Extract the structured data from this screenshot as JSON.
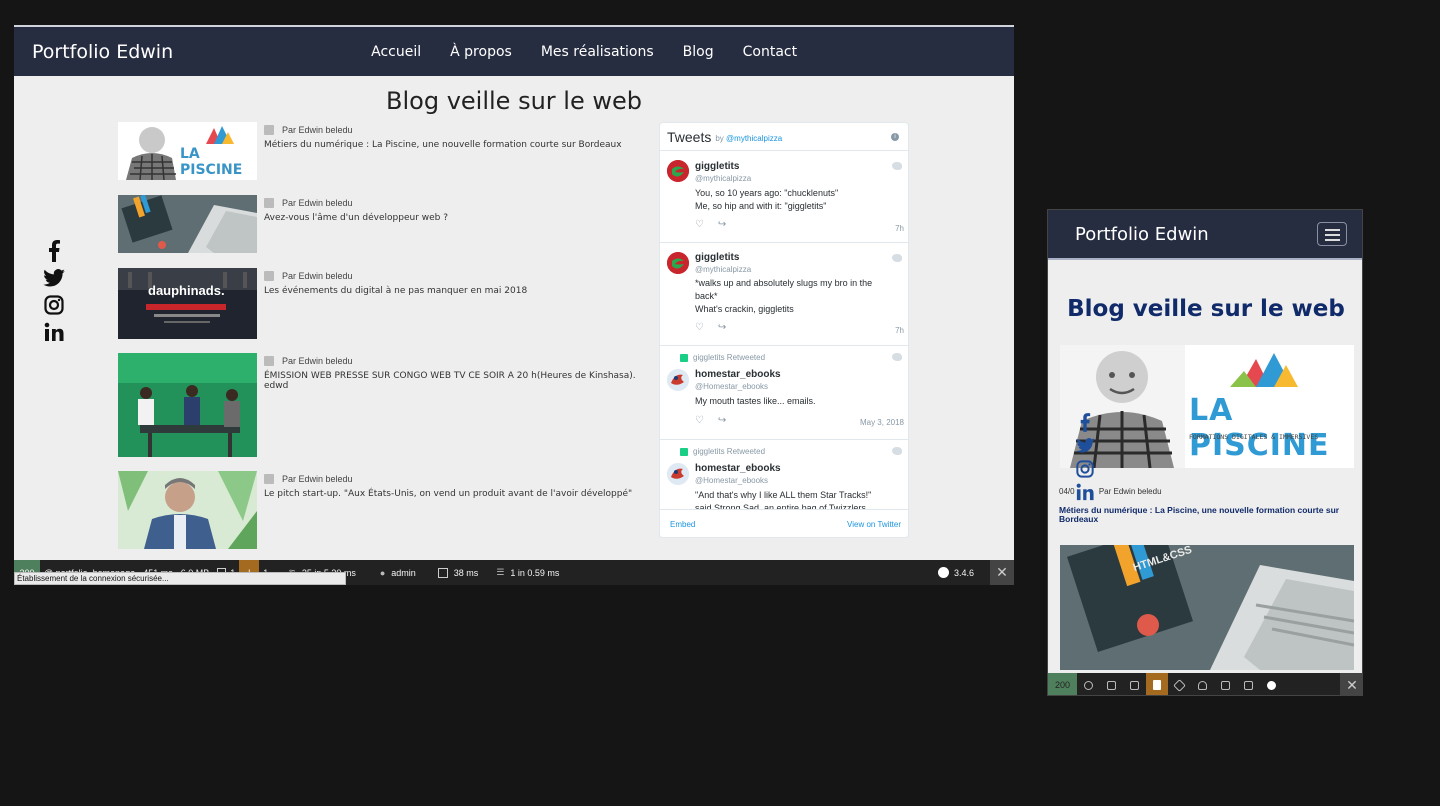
{
  "desktop": {
    "nav": {
      "brand": "Portfolio Edwin",
      "items": [
        "Accueil",
        "À propos",
        "Mes réalisations",
        "Blog",
        "Contact"
      ]
    },
    "page_title": "Blog veille sur le web",
    "social_icons": [
      "facebook-icon",
      "twitter-icon",
      "instagram-icon",
      "linkedin-icon"
    ],
    "posts": [
      {
        "author": "Par Edwin beledu",
        "title": "Métiers du numérique : La Piscine, une nouvelle formation courte sur Bordeaux",
        "thumb_text": "LA PISCINE"
      },
      {
        "author": "Par Edwin beledu",
        "title": "Avez-vous l'âme d'un développeur web ?"
      },
      {
        "author": "Par Edwin beledu",
        "title": "Les événements du digital à ne pas manquer en mai 2018",
        "thumb_text": "dauphinads."
      },
      {
        "author": "Par Edwin beledu",
        "title": "ÉMISSION WEB PRESSE SUR CONGO WEB TV CE SOIR A 20 h(Heures de Kinshasa). edwd"
      },
      {
        "author": "Par Edwin beledu",
        "title": "Le pitch start-up. \"Aux États-Unis, on vend un produit avant de l'avoir développé\""
      }
    ],
    "twitter": {
      "heading": "Tweets",
      "by": "by",
      "handle": "@mythicalpizza",
      "tweets": [
        {
          "name": "giggletits",
          "handle": "@mythicalpizza",
          "lines": [
            "You, so 10 years ago: \"chucklenuts\"",
            "Me, so hip and with it: \"giggletits\""
          ],
          "time": "7h"
        },
        {
          "name": "giggletits",
          "handle": "@mythicalpizza",
          "lines": [
            "*walks up and absolutely slugs my bro in the",
            "back*",
            "What's crackin, giggletits"
          ],
          "time": "7h"
        },
        {
          "retweeted": "giggletits Retweeted",
          "name": "homestar_ebooks",
          "handle": "@Homestar_ebooks",
          "lines": [
            "My mouth tastes like... emails."
          ],
          "time": "May 3, 2018"
        },
        {
          "retweeted": "giggletits Retweeted",
          "name": "homestar_ebooks",
          "handle": "@Homestar_ebooks",
          "lines": [
            "\"And that's why I like ALL them Star Tracks!\"",
            "said Strong Sad, an entire bag of Twizzlers"
          ]
        }
      ],
      "embed": "Embed",
      "view": "View on Twitter"
    },
    "toolbar": {
      "status": "200",
      "route": "@ portfolio_homepage",
      "time": "451 ms",
      "memory": "6.0 MB",
      "forms": "1",
      "warnings": "1",
      "events": "25 in 5.30 ms",
      "user": "admin",
      "twig": "38 ms",
      "db": "1 in 0.59 ms",
      "version": "3.4.6",
      "close": "✕"
    },
    "status_message": "Établissement de la connexion sécurisée..."
  },
  "mobile": {
    "brand": "Portfolio Edwin",
    "page_title": "Blog veille sur le web",
    "post": {
      "thumb_text": "LA PISCINE",
      "thumb_sub": "FORMATIONS DIGITALES & IMMERSIVES",
      "date": "04/0",
      "author": "Par Edwin beledu",
      "title": "Métiers du numérique : La Piscine, une nouvelle formation courte sur Bordeaux"
    },
    "second_thumb_text": "HTML&CSS",
    "toolbar": {
      "status": "200",
      "close": "✕"
    }
  },
  "colors": {
    "nav_bg": "#272d41",
    "page_bg": "#eeeeee",
    "mobile_title": "#102a6a",
    "toolbar_ok": "#4f805d",
    "toolbar_warn": "#a46a1f",
    "twitter_blue": "#1b95e0"
  }
}
